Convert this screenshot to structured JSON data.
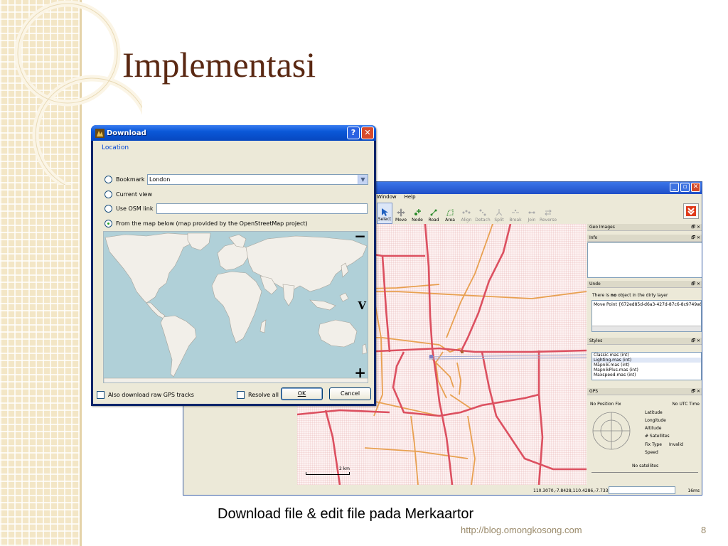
{
  "slide": {
    "title": "Implementasi",
    "caption": "Download file & edit file pada Merkaartor",
    "footer_url": "http://blog.omongkosong.com",
    "page_number": "8"
  },
  "dialog": {
    "title": "Download",
    "help_label": "?",
    "close_label": "✕",
    "group_label": "Location",
    "options": {
      "bookmark": "Bookmark",
      "current_view": "Current view",
      "osm_link": "Use OSM link",
      "from_map": "From the map below (map provided by the OpenStreetMap project)"
    },
    "selected_option": "from_map",
    "bookmark_value": "London",
    "osm_link_value": "",
    "map_controls": {
      "zoom_out": "−",
      "view": "V",
      "zoom_in": "+"
    },
    "checkboxes": {
      "gps_tracks": "Also download raw GPS tracks",
      "resolve_relations": "Resolve all relations"
    },
    "buttons": {
      "ok": "OK",
      "cancel": "Cancel"
    }
  },
  "merkaartor": {
    "menu": [
      "Window",
      "Help"
    ],
    "tools": [
      {
        "label": "Select",
        "icon": "cursor-icon",
        "enabled": true,
        "active": true
      },
      {
        "label": "Move",
        "icon": "move-icon",
        "enabled": true,
        "active": false
      },
      {
        "label": "Node",
        "icon": "node-icon",
        "enabled": true,
        "active": false
      },
      {
        "label": "Road",
        "icon": "road-icon",
        "enabled": true,
        "active": false
      },
      {
        "label": "Area",
        "icon": "area-icon",
        "enabled": true,
        "active": false
      },
      {
        "label": "Align",
        "icon": "align-icon",
        "enabled": false,
        "active": false
      },
      {
        "label": "Detach",
        "icon": "detach-icon",
        "enabled": false,
        "active": false
      },
      {
        "label": "Split",
        "icon": "split-icon",
        "enabled": false,
        "active": false
      },
      {
        "label": "Break",
        "icon": "break-icon",
        "enabled": false,
        "active": false
      },
      {
        "label": "Join",
        "icon": "join-icon",
        "enabled": false,
        "active": false
      },
      {
        "label": "Reverse",
        "icon": "reverse-icon",
        "enabled": false,
        "active": false
      }
    ],
    "scale_label": "2 km",
    "status": {
      "coords": "110.3070,-7.8428,110.4286,-7.7334",
      "time": "16ms"
    },
    "docks": {
      "geo_images": "Geo Images",
      "info": "Info",
      "undo": "Undo",
      "undo_text_pre": "There is ",
      "undo_text_bold": "no",
      "undo_text_post": " object in the dirty layer",
      "undo_item": "Move Point {672ed85d-d6a3-427d-87c6-8c9749a6f",
      "styles": "Styles",
      "style_items": [
        "Classic.mas (int)",
        "Lighting.mas (int)",
        "Mapnik.mas (int)",
        "MapnikPlus.mas (int)",
        "Maxspeed.mas (int)"
      ],
      "gps": "GPS",
      "gps_fix": "No Position Fix",
      "gps_time": "No UTC Time",
      "gps_fields": [
        "Latitude",
        "Longitude",
        "Altitude",
        "# Satellites",
        "Fix Type",
        "Speed"
      ],
      "gps_fix_type_value": "Invalid",
      "gps_satellites": "No satellites"
    },
    "colors": {
      "major_road": "#dc5060",
      "minor_road": "#e8a050"
    }
  }
}
